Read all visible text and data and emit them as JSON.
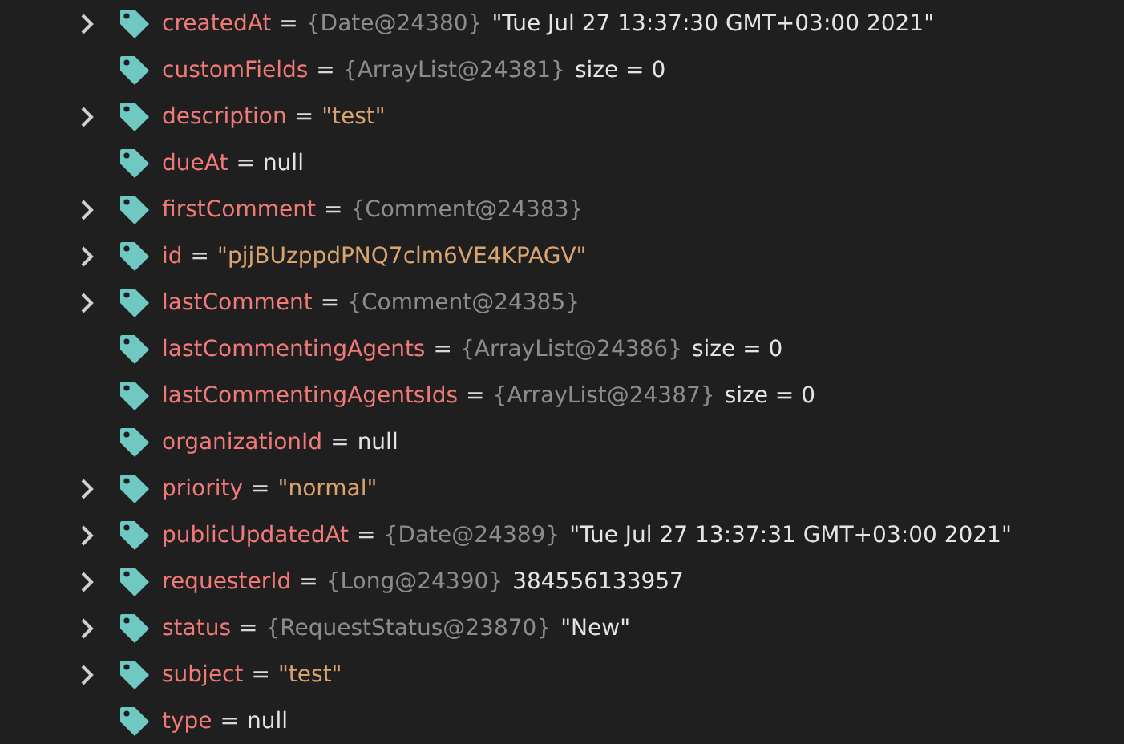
{
  "variables": [
    {
      "name": "createdAt",
      "op": "=",
      "expandable": true,
      "ref": "{Date@24380}",
      "value": "\"Tue Jul 27 13:37:30 GMT+03:00 2021\"",
      "string_literal": false
    },
    {
      "name": "customFields",
      "op": "=",
      "expandable": false,
      "ref": "{ArrayList@24381}",
      "value": "size = 0",
      "string_literal": false
    },
    {
      "name": "description",
      "op": "=",
      "expandable": true,
      "value": "\"test\"",
      "string_literal": true
    },
    {
      "name": "dueAt",
      "op": "=",
      "expandable": false,
      "value": "null",
      "string_literal": false
    },
    {
      "name": "firstComment",
      "op": "=",
      "expandable": true,
      "ref": "{Comment@24383}"
    },
    {
      "name": "id",
      "op": "=",
      "expandable": true,
      "value": "\"pjjBUzppdPNQ7clm6VE4KPAGV\"",
      "string_literal": true
    },
    {
      "name": "lastComment",
      "op": "=",
      "expandable": true,
      "ref": "{Comment@24385}"
    },
    {
      "name": "lastCommentingAgents",
      "op": "=",
      "expandable": false,
      "ref": "{ArrayList@24386}",
      "value": "size = 0",
      "string_literal": false
    },
    {
      "name": "lastCommentingAgentsIds",
      "op": "=",
      "expandable": false,
      "ref": "{ArrayList@24387}",
      "value": "size = 0",
      "string_literal": false
    },
    {
      "name": "organizationId",
      "op": "=",
      "expandable": false,
      "value": "null",
      "string_literal": false
    },
    {
      "name": "priority",
      "op": "=",
      "expandable": true,
      "value": "\"normal\"",
      "string_literal": true
    },
    {
      "name": "publicUpdatedAt",
      "op": "=",
      "expandable": true,
      "ref": "{Date@24389}",
      "value": "\"Tue Jul 27 13:37:31 GMT+03:00 2021\"",
      "string_literal": false
    },
    {
      "name": "requesterId",
      "op": "=",
      "expandable": true,
      "ref": "{Long@24390}",
      "value": "384556133957",
      "string_literal": false
    },
    {
      "name": "status",
      "op": "=",
      "expandable": true,
      "ref": "{RequestStatus@23870}",
      "value": "\"New\"",
      "string_literal": false
    },
    {
      "name": "subject",
      "op": "=",
      "expandable": true,
      "value": "\"test\"",
      "string_literal": true
    },
    {
      "name": "type",
      "op": "=",
      "expandable": false,
      "value": "null",
      "string_literal": false
    }
  ]
}
